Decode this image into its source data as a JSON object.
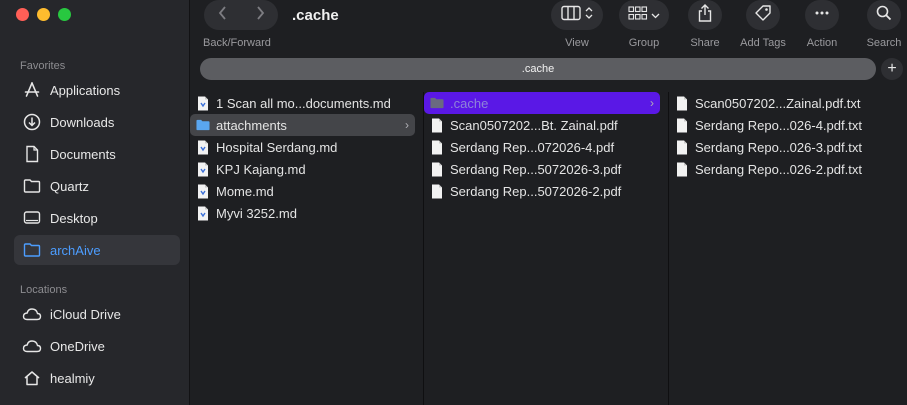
{
  "window": {
    "title": ".cache"
  },
  "toolbar": {
    "nav_label": "Back/Forward",
    "view": "View",
    "group": "Group",
    "share": "Share",
    "add_tags": "Add Tags",
    "action": "Action",
    "search": "Search"
  },
  "pathbar": {
    "label": ".cache",
    "add": "+"
  },
  "sidebar": {
    "favorites_title": "Favorites",
    "favorites": [
      {
        "label": "Applications",
        "icon": "applications-icon"
      },
      {
        "label": "Downloads",
        "icon": "downloads-icon"
      },
      {
        "label": "Documents",
        "icon": "document-icon"
      },
      {
        "label": "Quartz",
        "icon": "folder-icon"
      },
      {
        "label": "Desktop",
        "icon": "desktop-icon"
      },
      {
        "label": "archAive",
        "icon": "folder-icon",
        "active": true
      }
    ],
    "locations_title": "Locations",
    "locations": [
      {
        "label": "iCloud Drive",
        "icon": "cloud-icon"
      },
      {
        "label": "OneDrive",
        "icon": "cloud-icon"
      },
      {
        "label": "healmiy",
        "icon": "home-icon"
      }
    ]
  },
  "columns": [
    [
      {
        "name": "1 Scan all mo...documents.md",
        "kind": "file"
      },
      {
        "name": "attachments",
        "kind": "folder",
        "selected": "gray"
      },
      {
        "name": "Hospital Serdang.md",
        "kind": "file"
      },
      {
        "name": "KPJ Kajang.md",
        "kind": "file"
      },
      {
        "name": "Mome.md",
        "kind": "file"
      },
      {
        "name": "Myvi 3252.md",
        "kind": "file"
      }
    ],
    [
      {
        "name": ".cache",
        "kind": "folder",
        "selected": "purple"
      },
      {
        "name": "Scan0507202...Bt. Zainal.pdf",
        "kind": "file"
      },
      {
        "name": "Serdang Rep...072026-4.pdf",
        "kind": "file"
      },
      {
        "name": "Serdang Rep...5072026-3.pdf",
        "kind": "file"
      },
      {
        "name": "Serdang Rep...5072026-2.pdf",
        "kind": "file"
      }
    ],
    [
      {
        "name": "Scan0507202...Zainal.pdf.txt",
        "kind": "file"
      },
      {
        "name": "Serdang Repo...026-4.pdf.txt",
        "kind": "file"
      },
      {
        "name": "Serdang Repo...026-3.pdf.txt",
        "kind": "file"
      },
      {
        "name": "Serdang Repo...026-2.pdf.txt",
        "kind": "file"
      }
    ]
  ],
  "colors": {
    "accent": "#4c9dff",
    "selection_purple": "#5a18e6",
    "selection_gray": "#444549",
    "close": "#ff5f57",
    "minimize": "#febc2e",
    "zoom": "#28c840"
  }
}
